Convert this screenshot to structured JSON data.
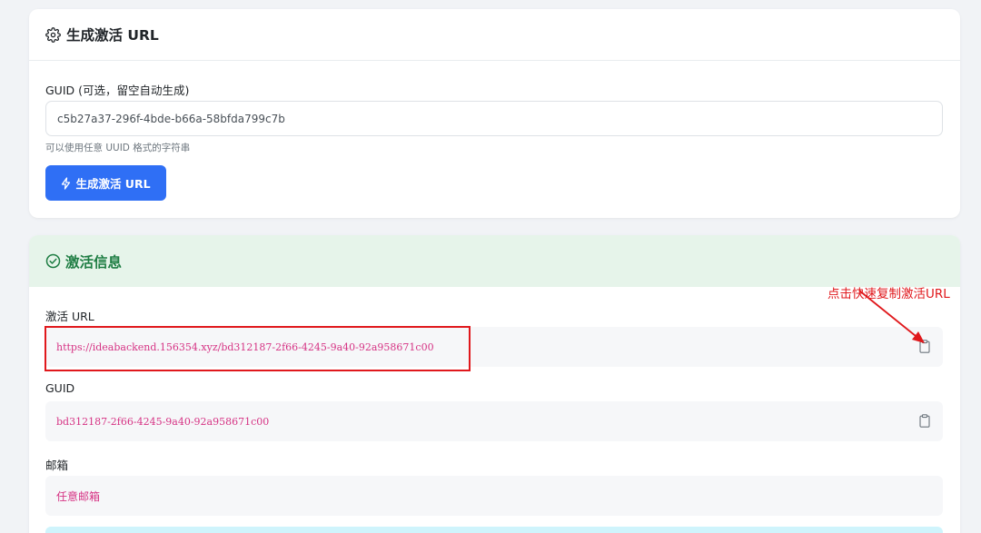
{
  "generator": {
    "title": "生成激活 URL",
    "guid_label": "GUID (可选，留空自动生成)",
    "guid_value": "c5b27a37-296f-4bde-b66a-58bfda799c7b",
    "hint": "可以使用任意 UUID 格式的字符串",
    "button_label": "生成激活 URL"
  },
  "activation": {
    "title": "激活信息",
    "url_label": "激活 URL",
    "url_value": "https://ideabackend.156354.xyz/bd312187-2f66-4245-9a40-92a958671c00",
    "guid_label": "GUID",
    "guid_value": "bd312187-2f66-4245-9a40-92a958671c00",
    "email_label": "邮箱",
    "email_value": "任意邮箱"
  },
  "annotation": {
    "text": "点击快速复制激活URL",
    "color": "#e0181c"
  },
  "colors": {
    "primary": "#2f6ff5",
    "success_text": "#1e7d43",
    "success_bg": "#e6f4ea",
    "code_text": "#d63384"
  },
  "icons": {
    "generator_header": "gear-icon",
    "generator_button": "lightning-icon",
    "activation_header": "check-circle-icon",
    "copy": "clipboard-icon"
  }
}
